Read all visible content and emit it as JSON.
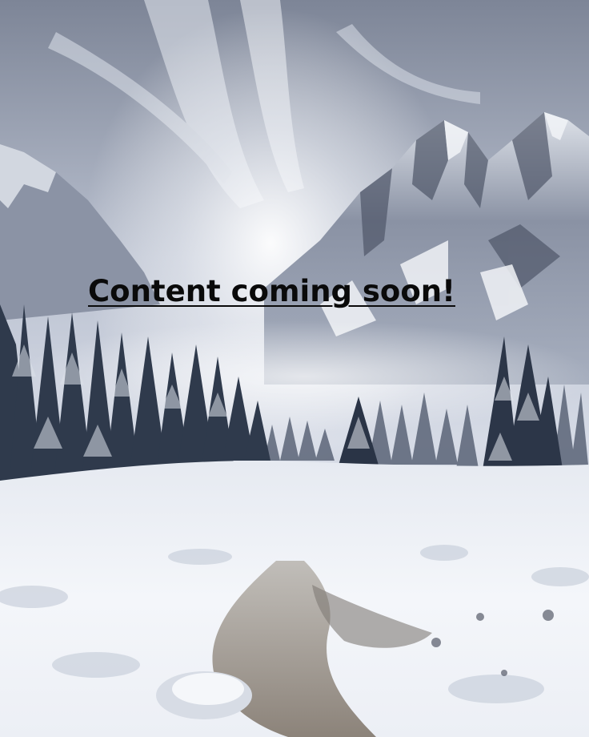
{
  "headline": {
    "text": "Content coming soon!"
  },
  "palette": {
    "sky_light": "#eef1f6",
    "sky_dark": "#6e7688",
    "mountain": "#8a92a4",
    "snow": "#f3f5f9",
    "forest": "#2f3a4c",
    "stream": "#8c8478"
  }
}
